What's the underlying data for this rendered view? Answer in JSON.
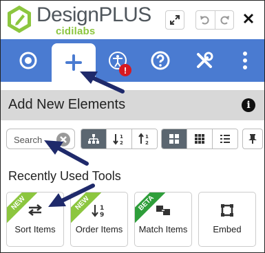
{
  "header": {
    "brand_design": "Design",
    "brand_plus": "PLUS",
    "tagline": "cidilabs",
    "expand_icon": "expand-icon",
    "undo_icon": "undo-icon",
    "redo_icon": "redo-icon",
    "close_icon": "close-icon"
  },
  "tabs": [
    {
      "icon": "target-icon",
      "active": false
    },
    {
      "icon": "plus-icon",
      "active": true
    },
    {
      "icon": "accessibility-icon",
      "active": false,
      "badge": "!"
    },
    {
      "icon": "help-icon",
      "active": false
    },
    {
      "icon": "tools-icon",
      "active": false
    },
    {
      "icon": "more-vertical-icon",
      "active": false
    }
  ],
  "section": {
    "title": "Add New Elements",
    "info": "i"
  },
  "toolbar": {
    "search_placeholder": "Search",
    "sort_buttons": [
      "hierarchy-icon",
      "sort-az-icon",
      "sort-za-icon"
    ],
    "view_buttons": [
      "large-grid-icon",
      "small-grid-icon",
      "list-icon"
    ],
    "pin_icon": "pin-icon"
  },
  "recent": {
    "title": "Recently Used Tools",
    "items": [
      {
        "label": "Sort Items",
        "ribbon": "NEW",
        "ribbon_color": "#8cc63f"
      },
      {
        "label": "Order Items",
        "ribbon": "NEW",
        "ribbon_color": "#8cc63f"
      },
      {
        "label": "Match Items",
        "ribbon": "BETA",
        "ribbon_color": "#2e9e3a"
      },
      {
        "label": "Embed",
        "ribbon": ""
      }
    ]
  },
  "colors": {
    "tab_bar": "#4a7bd1",
    "brand_green": "#8cc63f",
    "arrow": "#1f2a6b"
  }
}
